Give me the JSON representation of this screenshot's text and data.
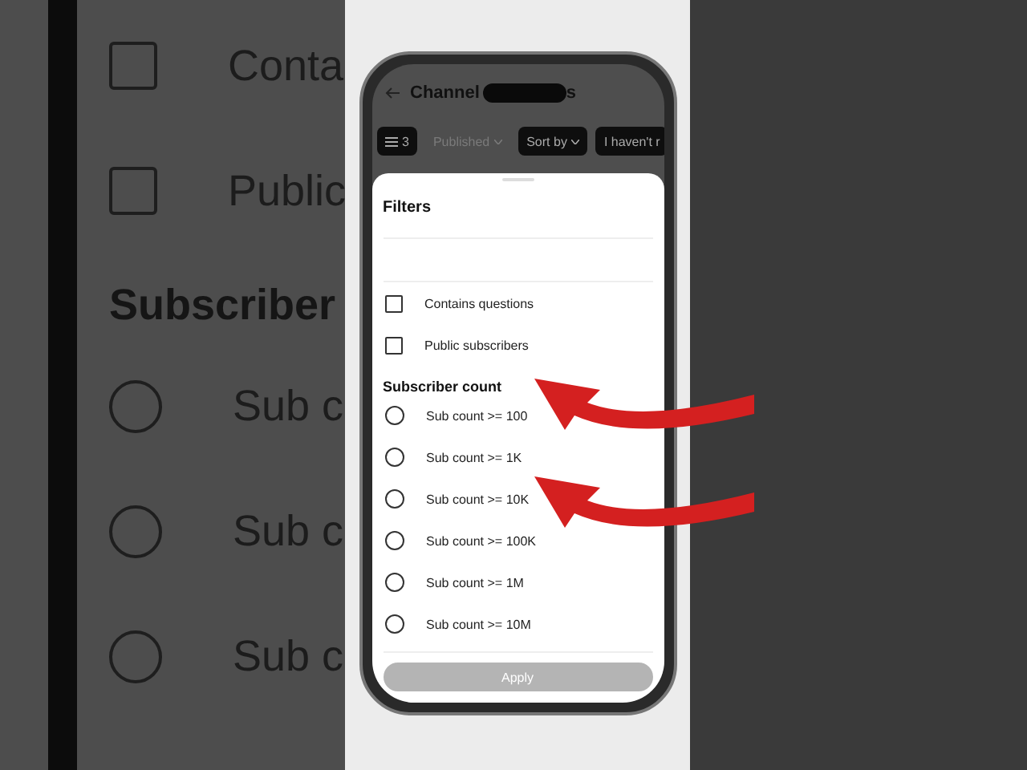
{
  "background": {
    "checkboxes": [
      {
        "label": "Conta",
        "checked": false
      },
      {
        "label": "Public",
        "checked": false
      }
    ],
    "heading": "Subscriber",
    "radios": [
      {
        "label": "Sub c",
        "selected": false
      },
      {
        "label": "Sub c",
        "selected": false
      },
      {
        "label": "Sub c",
        "selected": false
      }
    ]
  },
  "screen": {
    "title_start": "Channel",
    "title_end": "s",
    "chips": [
      {
        "kind": "filter",
        "label": "3",
        "disabled": false
      },
      {
        "kind": "dropdown",
        "label": "Published",
        "disabled": true
      },
      {
        "kind": "dropdown",
        "label": "Sort by",
        "disabled": false
      },
      {
        "kind": "plain",
        "label": "I haven't r",
        "disabled": false
      }
    ]
  },
  "sheet": {
    "title": "Filters",
    "checkboxes": [
      {
        "label": "Contains questions",
        "checked": false
      },
      {
        "label": "Public subscribers",
        "checked": false
      }
    ],
    "section": "Subscriber count",
    "options": [
      {
        "label": "Sub count >= 100",
        "selected": false
      },
      {
        "label": "Sub count >= 1K",
        "selected": false
      },
      {
        "label": "Sub count >= 10K",
        "selected": false
      },
      {
        "label": "Sub count >= 100K",
        "selected": false
      },
      {
        "label": "Sub count >= 1M",
        "selected": false
      },
      {
        "label": "Sub count >= 10M",
        "selected": false
      }
    ],
    "apply": {
      "label": "Apply",
      "disabled": true
    }
  }
}
